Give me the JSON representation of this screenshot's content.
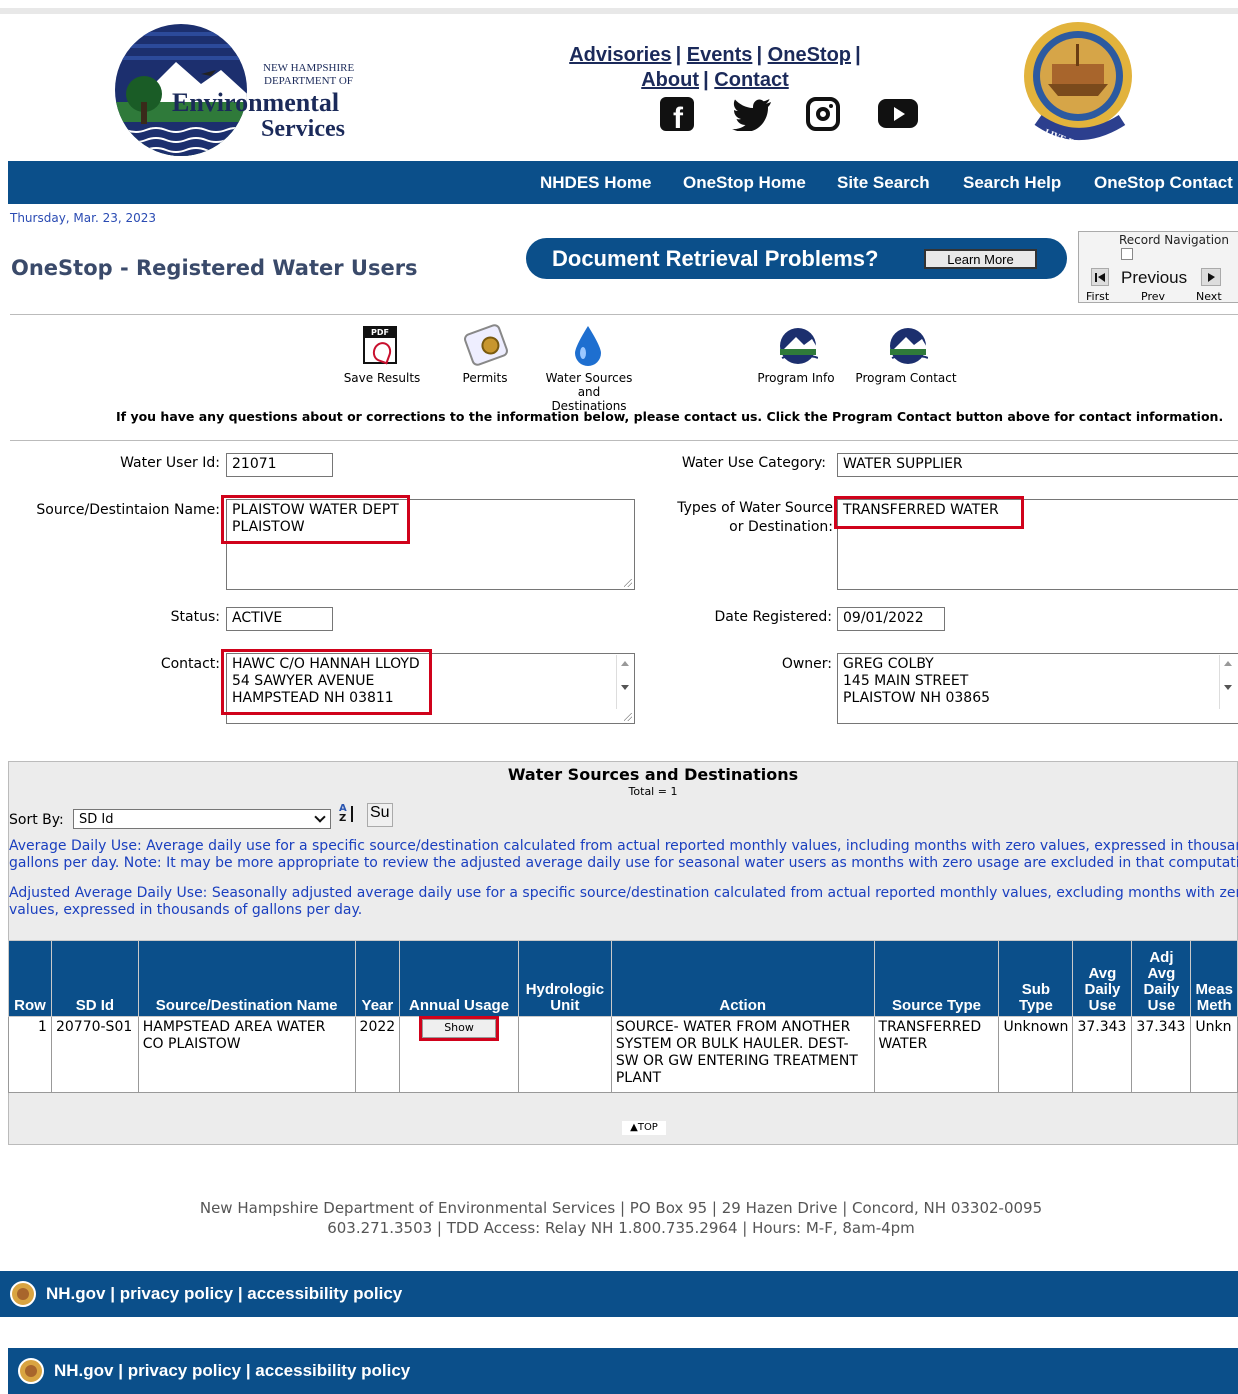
{
  "header": {
    "logo_lines": [
      "NEW HAMPSHIRE",
      "DEPARTMENT OF",
      "Environmental",
      "Services"
    ],
    "top_links": [
      "Advisories",
      "Events",
      "OneStop",
      "About",
      "Contact"
    ],
    "social_icons": [
      "facebook-icon",
      "twitter-icon",
      "instagram-icon",
      "youtube-icon"
    ],
    "seal_motto": "LIVE FREE OR DIE"
  },
  "nav": [
    "NHDES Home",
    "OneStop Home",
    "Site Search",
    "Search Help",
    "OneStop Contact"
  ],
  "date": "Thursday, Mar. 23, 2023",
  "page_title": "OneStop - Registered Water Users",
  "banner": {
    "text": "Document Retrieval Problems?",
    "button": "Learn More"
  },
  "record_nav": {
    "title": "Record Navigation",
    "prev_img_alt": "Previous",
    "first": "First",
    "prev": "Prev",
    "next": "Next"
  },
  "toolbar": [
    {
      "label": "Save Results",
      "icon": "pdf-icon"
    },
    {
      "label": "Permits",
      "icon": "permits-icon"
    },
    {
      "label": "Water Sources and Destinations",
      "icon": "water-drop-icon"
    },
    {
      "label": "Program Info",
      "icon": "program-logo-icon"
    },
    {
      "label": "Program Contact",
      "icon": "program-logo-icon"
    }
  ],
  "notice": "If you have any questions about or corrections to the information below, please contact us. Click the Program Contact button above for contact information.",
  "form": {
    "water_user_id_label": "Water User Id:",
    "water_user_id": "21071",
    "category_label": "Water Use Category:",
    "category": "WATER SUPPLIER",
    "source_name_label": "Source/Destintaion Name:",
    "source_name": [
      "PLAISTOW WATER DEPT",
      "PLAISTOW"
    ],
    "types_label_1": "Types of Water Source",
    "types_label_2": "or Destination:",
    "types": "TRANSFERRED WATER",
    "status_label": "Status:",
    "status": "ACTIVE",
    "date_registered_label": "Date Registered:",
    "date_registered": "09/01/2022",
    "contact_label": "Contact:",
    "contact": [
      "HAWC C/O HANNAH LLOYD",
      "54 SAWYER AVENUE",
      "HAMPSTEAD NH 03811"
    ],
    "owner_label": "Owner:",
    "owner": [
      "GREG COLBY",
      "145 MAIN STREET",
      "PLAISTOW NH 03865"
    ]
  },
  "sources": {
    "title": "Water Sources and Destinations",
    "total": "Total = 1",
    "sort_label": "Sort By:",
    "sort_value": "SD Id",
    "sort_btn": "Su",
    "note1": "Average Daily Use: Average daily use for a specific source/destination calculated from actual reported monthly values, including months with zero values, expressed in thousands of gallons per day. Note: It may be more appropriate to review the adjusted average daily use for seasonal water users as months with zero usage are excluded in that computation.",
    "note2": "Adjusted Average Daily Use: Seasonally adjusted average daily use for a specific source/destination calculated from actual reported monthly values, excluding months with zero values, expressed in thousands of gallons per day.",
    "columns": [
      "Row",
      "SD Id",
      "Source/Destination Name",
      "Year",
      "Annual Usage",
      "Hydrologic Unit",
      "Action",
      "Source Type",
      "Sub Type",
      "Avg Daily Use",
      "Adj Avg Daily Use",
      "Meas Meth"
    ],
    "rows": [
      {
        "row": "1",
        "sd_id": "20770-S01",
        "name": "HAMPSTEAD AREA WATER CO PLAISTOW",
        "year": "2022",
        "annual_usage_btn": "Show",
        "huc": "",
        "action": "SOURCE- WATER FROM ANOTHER SYSTEM OR BULK HAULER. DEST- SW OR GW ENTERING TREATMENT PLANT",
        "source_type": "TRANSFERRED WATER",
        "sub_type": "Unknown",
        "avg": "37.343",
        "adj_avg": "37.343",
        "meas": "Unkn"
      }
    ],
    "top_link": "▲TOP"
  },
  "footer": {
    "line1": "New Hampshire Department of Environmental Services | PO Box 95 | 29 Hazen Drive | Concord, NH  03302-0095",
    "line2": "603.271.3503 | TDD Access: Relay NH 1.800.735.2964 | Hours: M-F, 8am-4pm",
    "bar_text": "NH.gov | privacy policy | accessibility policy"
  }
}
